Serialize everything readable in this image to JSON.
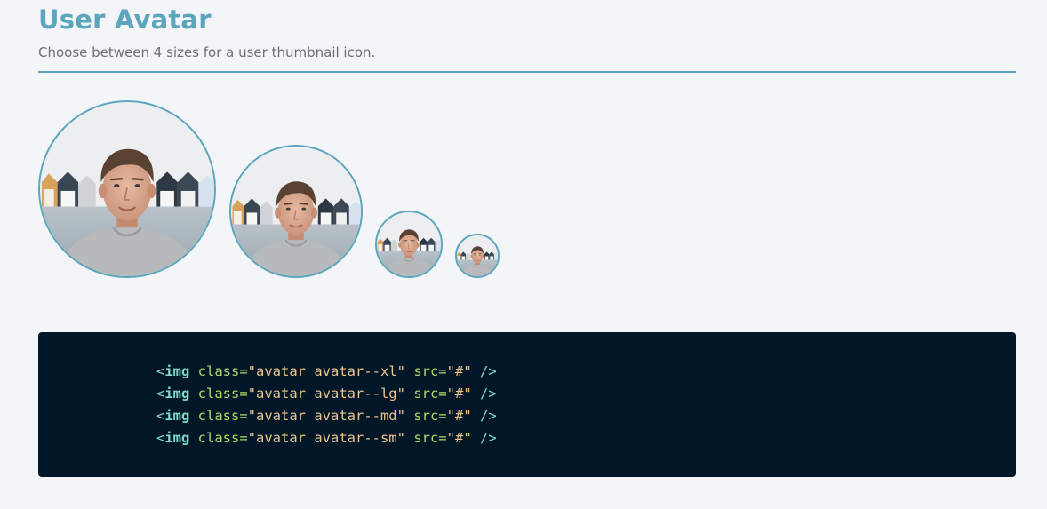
{
  "header": {
    "title": "User Avatar",
    "subtitle": "Choose between 4 sizes for a user thumbnail icon."
  },
  "colors": {
    "accent": "#5ba6bd",
    "page_background": "#f4f5f9",
    "code_background": "#011627"
  },
  "avatars": [
    {
      "size": "xl",
      "alt": "user avatar extra large"
    },
    {
      "size": "lg",
      "alt": "user avatar large"
    },
    {
      "size": "md",
      "alt": "user avatar medium"
    },
    {
      "size": "sm",
      "alt": "user avatar small"
    }
  ],
  "code": {
    "lines": [
      {
        "open": "<",
        "tag": "img",
        "attr1": " class=",
        "val1": "\"avatar avatar--xl\"",
        "attr2": " src=",
        "val2": "\"#\"",
        "close": " />"
      },
      {
        "open": "<",
        "tag": "img",
        "attr1": " class=",
        "val1": "\"avatar avatar--lg\"",
        "attr2": " src=",
        "val2": "\"#\"",
        "close": " />"
      },
      {
        "open": "<",
        "tag": "img",
        "attr1": " class=",
        "val1": "\"avatar avatar--md\"",
        "attr2": " src=",
        "val2": "\"#\"",
        "close": " />"
      },
      {
        "open": "<",
        "tag": "img",
        "attr1": " class=",
        "val1": "\"avatar avatar--sm\"",
        "attr2": " src=",
        "val2": "\"#\"",
        "close": " />"
      }
    ]
  }
}
